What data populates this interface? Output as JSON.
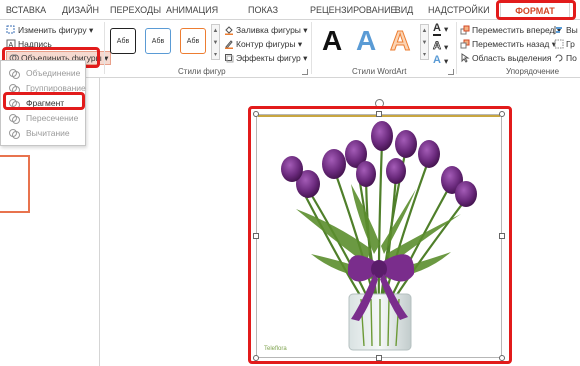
{
  "tabs": [
    {
      "label": "ВСТАВКА"
    },
    {
      "label": "ДИЗАЙН"
    },
    {
      "label": "ПЕРЕХОДЫ"
    },
    {
      "label": "АНИМАЦИЯ"
    },
    {
      "label": "ПОКАЗ СЛАЙДОВ"
    },
    {
      "label": "РЕЦЕНЗИРОВАНИЕ"
    },
    {
      "label": "ВИД"
    },
    {
      "label": "НАДСТРОЙКИ"
    },
    {
      "label": "ФОРМАТ"
    }
  ],
  "ribbon": {
    "insert": {
      "change_shape": "Изменить фигуру",
      "text_box": "Надпись",
      "merge_shapes": "Объединить фигуры"
    },
    "shape_styles": {
      "label": "Стили фигур",
      "sample": "Абв",
      "fill": "Заливка фигуры",
      "outline": "Контур фигуры",
      "effects": "Эффекты фигур"
    },
    "wordart": {
      "label": "Стили WordArt",
      "sample": "A"
    },
    "arrange": {
      "label": "Упорядочение",
      "forward": "Переместить вперед",
      "backward": "Переместить назад",
      "selection_pane": "Область выделения",
      "cut1": "Вы",
      "cut2": "Гр",
      "cut3": "По"
    }
  },
  "merge_menu": [
    {
      "label": "Объединение",
      "enabled": false
    },
    {
      "label": "Группирование",
      "enabled": false
    },
    {
      "label": "Фрагмент",
      "enabled": true
    },
    {
      "label": "Пересечение",
      "enabled": false
    },
    {
      "label": "Вычитание",
      "enabled": false
    }
  ],
  "colors": {
    "accent": "#d24726",
    "highlight": "#e21b1b",
    "tulip": "#6b2a7d"
  },
  "image": {
    "watermark": "Teleflora"
  }
}
